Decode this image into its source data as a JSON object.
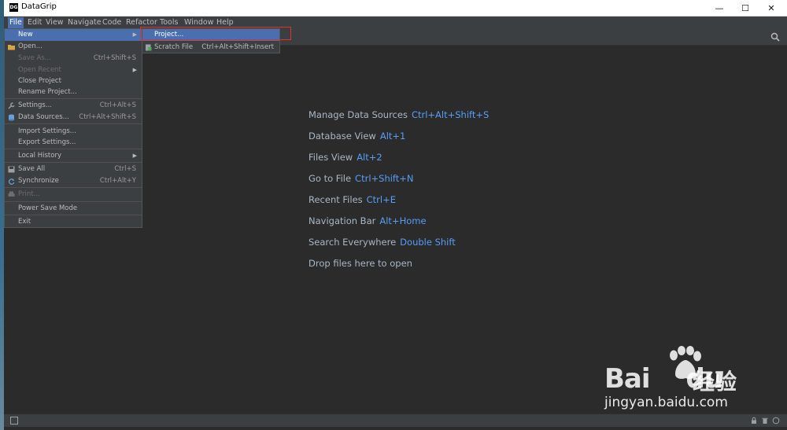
{
  "window": {
    "app_logo_text": "DG",
    "title": "DataGrip",
    "minimize_glyph": "—",
    "maximize_glyph": "☐",
    "close_glyph": "✕"
  },
  "menubar": {
    "items": [
      "File",
      "Edit",
      "View",
      "Navigate",
      "Code",
      "Refactor",
      "Tools",
      "Window",
      "Help"
    ],
    "active": "File"
  },
  "file_menu": {
    "items": [
      {
        "label": "New",
        "shortcut": "",
        "submenu": true,
        "highlighted": true,
        "disabled": false,
        "icon": ""
      },
      {
        "label": "Open...",
        "shortcut": "",
        "submenu": false,
        "disabled": false,
        "icon": "folder-icon"
      },
      {
        "label": "Save As...",
        "shortcut": "Ctrl+Shift+S",
        "submenu": false,
        "disabled": true,
        "icon": ""
      },
      {
        "label": "Open Recent",
        "shortcut": "",
        "submenu": true,
        "disabled": true,
        "icon": ""
      },
      {
        "label": "Close Project",
        "shortcut": "",
        "submenu": false,
        "disabled": false,
        "icon": ""
      },
      {
        "label": "Rename Project...",
        "shortcut": "",
        "submenu": false,
        "disabled": false,
        "icon": ""
      },
      {
        "label": "Settings...",
        "shortcut": "Ctrl+Alt+S",
        "submenu": false,
        "disabled": false,
        "icon": "wrench-icon"
      },
      {
        "label": "Data Sources...",
        "shortcut": "Ctrl+Alt+Shift+S",
        "submenu": false,
        "disabled": false,
        "icon": "database-icon"
      },
      {
        "label": "Import Settings...",
        "shortcut": "",
        "submenu": false,
        "disabled": false,
        "icon": ""
      },
      {
        "label": "Export Settings...",
        "shortcut": "",
        "submenu": false,
        "disabled": false,
        "icon": ""
      },
      {
        "label": "Local History",
        "shortcut": "",
        "submenu": true,
        "disabled": false,
        "icon": ""
      },
      {
        "label": "Save All",
        "shortcut": "Ctrl+S",
        "submenu": false,
        "disabled": false,
        "icon": "save-icon"
      },
      {
        "label": "Synchronize",
        "shortcut": "Ctrl+Alt+Y",
        "submenu": false,
        "disabled": false,
        "icon": "sync-icon"
      },
      {
        "label": "Print...",
        "shortcut": "",
        "submenu": false,
        "disabled": true,
        "icon": "print-icon"
      },
      {
        "label": "Power Save Mode",
        "shortcut": "",
        "submenu": false,
        "disabled": false,
        "icon": ""
      },
      {
        "label": "Exit",
        "shortcut": "",
        "submenu": false,
        "disabled": false,
        "icon": ""
      }
    ]
  },
  "new_submenu": {
    "items": [
      {
        "label": "Project...",
        "shortcut": "",
        "highlighted": true,
        "icon": ""
      },
      {
        "label": "Scratch File",
        "shortcut": "Ctrl+Alt+Shift+Insert",
        "highlighted": false,
        "icon": "scratch-file-icon"
      }
    ]
  },
  "welcome_hints": [
    {
      "label": "Manage Data Sources",
      "key": "Ctrl+Alt+Shift+S"
    },
    {
      "label": "Database View",
      "key": "Alt+1"
    },
    {
      "label": "Files View",
      "key": "Alt+2"
    },
    {
      "label": "Go to File",
      "key": "Ctrl+Shift+N"
    },
    {
      "label": "Recent Files",
      "key": "Ctrl+E"
    },
    {
      "label": "Navigation Bar",
      "key": "Alt+Home"
    },
    {
      "label": "Search Everywhere",
      "key": "Double Shift"
    },
    {
      "label": "Drop files here to open",
      "key": ""
    }
  ],
  "watermark": {
    "brand": "Bai",
    "brand_suffix": "du",
    "chinese": "经验",
    "url": "jingyan.baidu.com"
  },
  "colors": {
    "accent": "#4b6eaf",
    "shortcut_blue": "#589df6",
    "annotation_red": "#e03030"
  }
}
